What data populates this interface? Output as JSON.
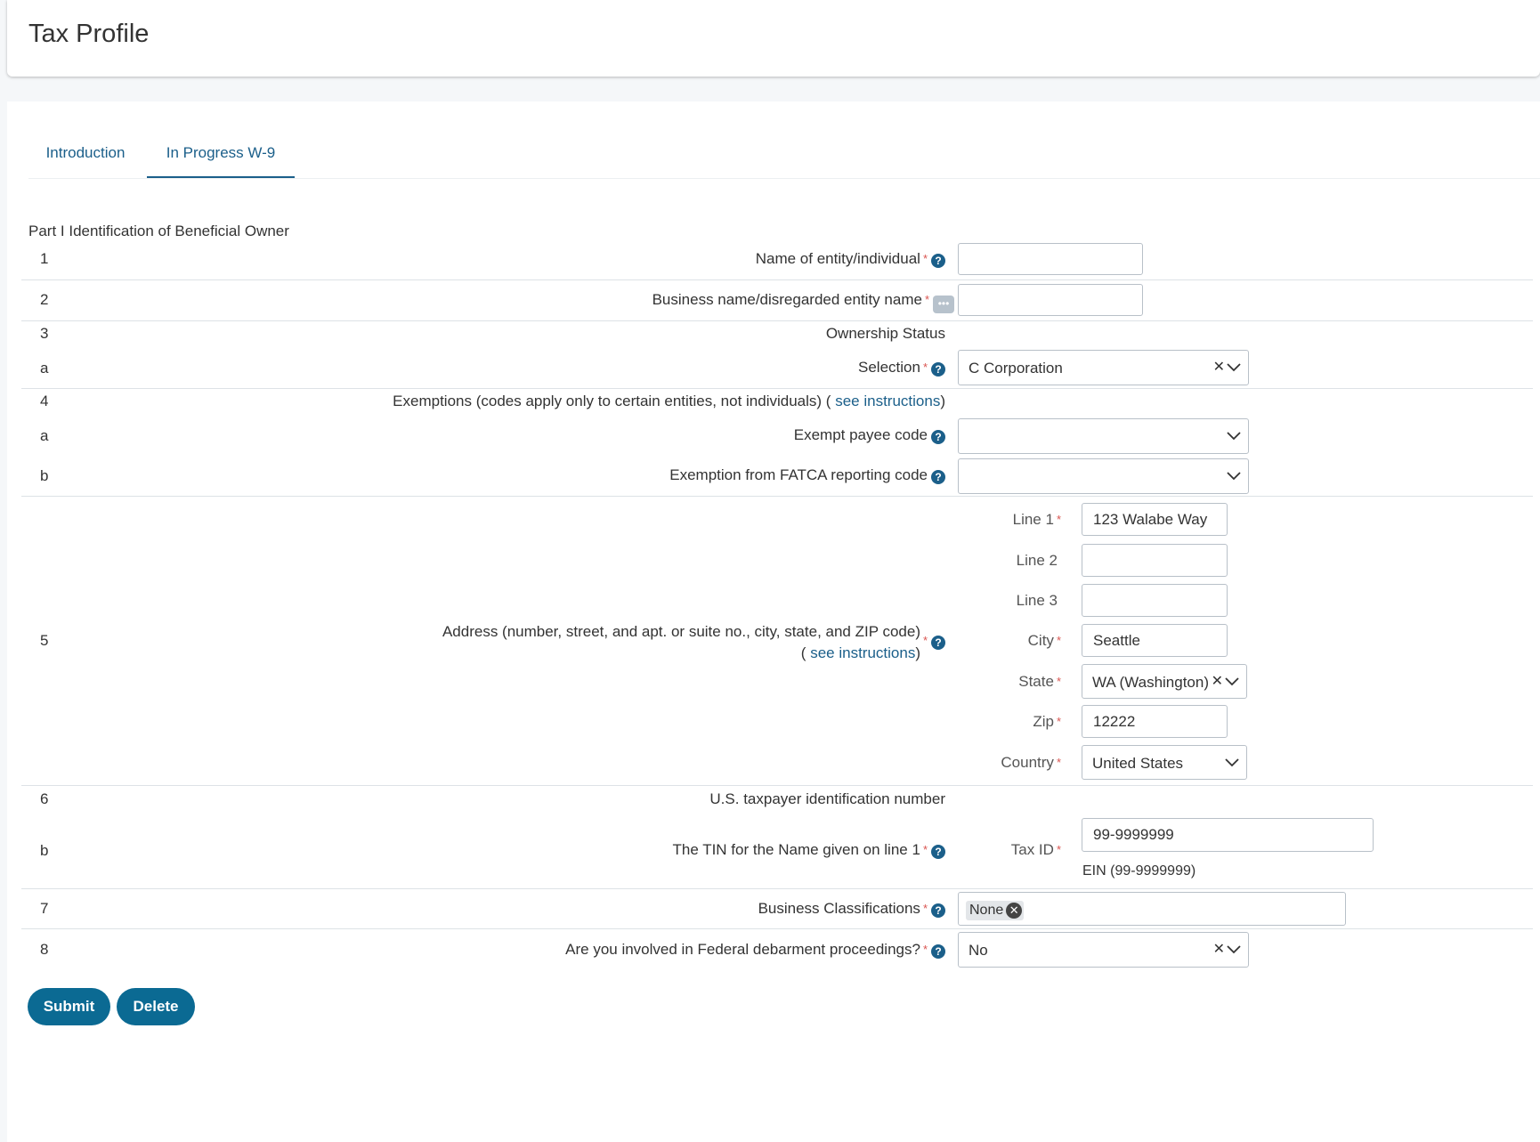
{
  "header": {
    "title": "Tax Profile"
  },
  "tabs": [
    {
      "label": "Introduction"
    },
    {
      "label": "In Progress W-9"
    }
  ],
  "section_title": "Part I Identification of Beneficial Owner",
  "rows": {
    "r1": {
      "num": "1",
      "label": "Name of entity/individual",
      "value": ""
    },
    "r2": {
      "num": "2",
      "label": "Business name/disregarded entity name",
      "value": ""
    },
    "r3": {
      "num": "3",
      "label": "Ownership Status"
    },
    "r3a": {
      "num": "a",
      "label": "Selection",
      "value": "C Corporation"
    },
    "r4": {
      "num": "4",
      "label": "Exemptions (codes apply only to certain entities, not individuals) (",
      "link": "see instructions",
      "close": ")"
    },
    "r4a": {
      "num": "a",
      "label": "Exempt payee code",
      "value": ""
    },
    "r4b": {
      "num": "b",
      "label": "Exemption from FATCA reporting code",
      "value": ""
    },
    "r5": {
      "num": "5",
      "label": "Address (number, street, and apt. or suite no., city, state, and ZIP code)",
      "link_open": "(",
      "link": "see instructions",
      "link_close": ")",
      "line1_label": "Line 1",
      "line1": "123 Walabe Way",
      "line2_label": "Line 2",
      "line2": "",
      "line3_label": "Line 3",
      "line3": "",
      "city_label": "City",
      "city": "Seattle",
      "state_label": "State",
      "state": "WA (Washington)",
      "zip_label": "Zip",
      "zip": "12222",
      "country_label": "Country",
      "country": "United States"
    },
    "r6": {
      "num": "6",
      "label": "U.S. taxpayer identification number"
    },
    "r6b": {
      "num": "b",
      "label": "The TIN for the Name given on line 1",
      "taxid_label": "Tax ID",
      "taxid": "99-9999999",
      "hint": "EIN (99-9999999)"
    },
    "r7": {
      "num": "7",
      "label": "Business Classifications",
      "tag": "None"
    },
    "r8": {
      "num": "8",
      "label": "Are you involved in Federal debarment proceedings?",
      "value": "No"
    }
  },
  "buttons": {
    "submit": "Submit",
    "delete": "Delete"
  },
  "icons": {
    "help": "question-circle-icon",
    "more": "ellipsis-icon",
    "clear": "x-icon",
    "chevron": "chevron-down-icon"
  },
  "colors": {
    "accent": "#1b5f8a",
    "button": "#0b6a93",
    "required": "#d9534f"
  }
}
